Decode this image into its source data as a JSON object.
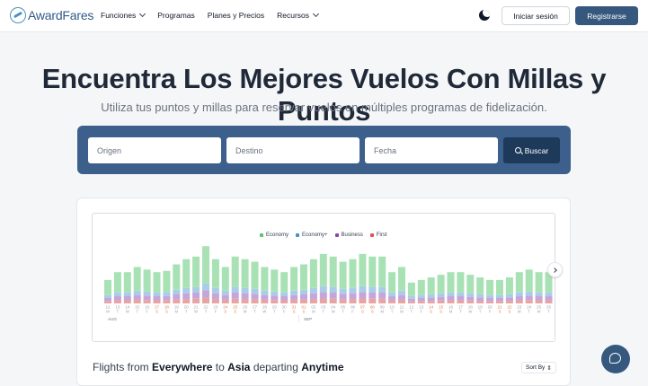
{
  "nav": {
    "logo": "AwardFares",
    "menu": [
      {
        "label": "Funciones",
        "dropdown": true
      },
      {
        "label": "Programas",
        "dropdown": false
      },
      {
        "label": "Planes y Precios",
        "dropdown": false
      },
      {
        "label": "Recursos",
        "dropdown": true
      }
    ],
    "login": "Iniciar sesión",
    "register": "Registrarse"
  },
  "hero": {
    "title": "Encuentra Los Mejores Vuelos Con Millas y Puntos",
    "subtitle": "Utiliza tus puntos y millas para reservar vuelos en múltiples programas de fidelización."
  },
  "search": {
    "origin_placeholder": "Origen",
    "destination_placeholder": "Destino",
    "date_placeholder": "Fecha",
    "button": "Buscar"
  },
  "chart_data": {
    "type": "bar",
    "stacked": true,
    "legend": [
      {
        "name": "Economy",
        "color": "#5cc277"
      },
      {
        "name": "Economy+",
        "color": "#4a90c2"
      },
      {
        "name": "Business",
        "color": "#8e44ad"
      },
      {
        "name": "First",
        "color": "#e05151"
      }
    ],
    "days": [
      "12",
      "13",
      "14",
      "15",
      "16",
      "17",
      "18",
      "19",
      "20",
      "21",
      "22",
      "23",
      "24",
      "25",
      "26",
      "27",
      "28",
      "29",
      "30",
      "31",
      "01",
      "02",
      "03",
      "04",
      "05",
      "06",
      "07",
      "08",
      "09",
      "10",
      "11",
      "12",
      "13",
      "14",
      "15",
      "16",
      "17",
      "18",
      "19",
      "20",
      "21",
      "22",
      "23",
      "24",
      "25",
      "26"
    ],
    "weekdays": [
      "M",
      "T",
      "W",
      "T",
      "F",
      "S",
      "S",
      "M",
      "T",
      "W",
      "T",
      "F",
      "S",
      "S",
      "M",
      "T",
      "W",
      "T",
      "F",
      "S",
      "S",
      "M",
      "T",
      "W",
      "T",
      "F",
      "S",
      "S",
      "M",
      "T",
      "W",
      "T",
      "F",
      "S",
      "S",
      "M",
      "T",
      "W",
      "T",
      "F",
      "S",
      "S",
      "M",
      "T",
      "W",
      "T"
    ],
    "weekend": [
      false,
      false,
      false,
      false,
      false,
      true,
      true,
      false,
      false,
      false,
      false,
      false,
      true,
      true,
      false,
      false,
      false,
      false,
      false,
      true,
      true,
      false,
      false,
      false,
      false,
      false,
      true,
      true,
      false,
      false,
      false,
      false,
      false,
      true,
      true,
      false,
      false,
      false,
      false,
      false,
      true,
      true,
      false,
      false,
      false,
      false
    ],
    "values": [
      18,
      24,
      24,
      28,
      26,
      24,
      25,
      30,
      34,
      36,
      44,
      34,
      28,
      36,
      34,
      32,
      28,
      26,
      24,
      28,
      30,
      34,
      38,
      36,
      32,
      34,
      38,
      36,
      36,
      24,
      28,
      16,
      18,
      20,
      22,
      24,
      24,
      22,
      20,
      18,
      18,
      20,
      24,
      26,
      24,
      24
    ],
    "months": [
      "AUG",
      "SEP"
    ]
  },
  "card": {
    "flights_prefix": "Flights from",
    "from": "Everywhere",
    "to_word": "to",
    "to": "Asia",
    "departing_word": "departing",
    "when": "Anytime",
    "sort": "Sort By"
  }
}
